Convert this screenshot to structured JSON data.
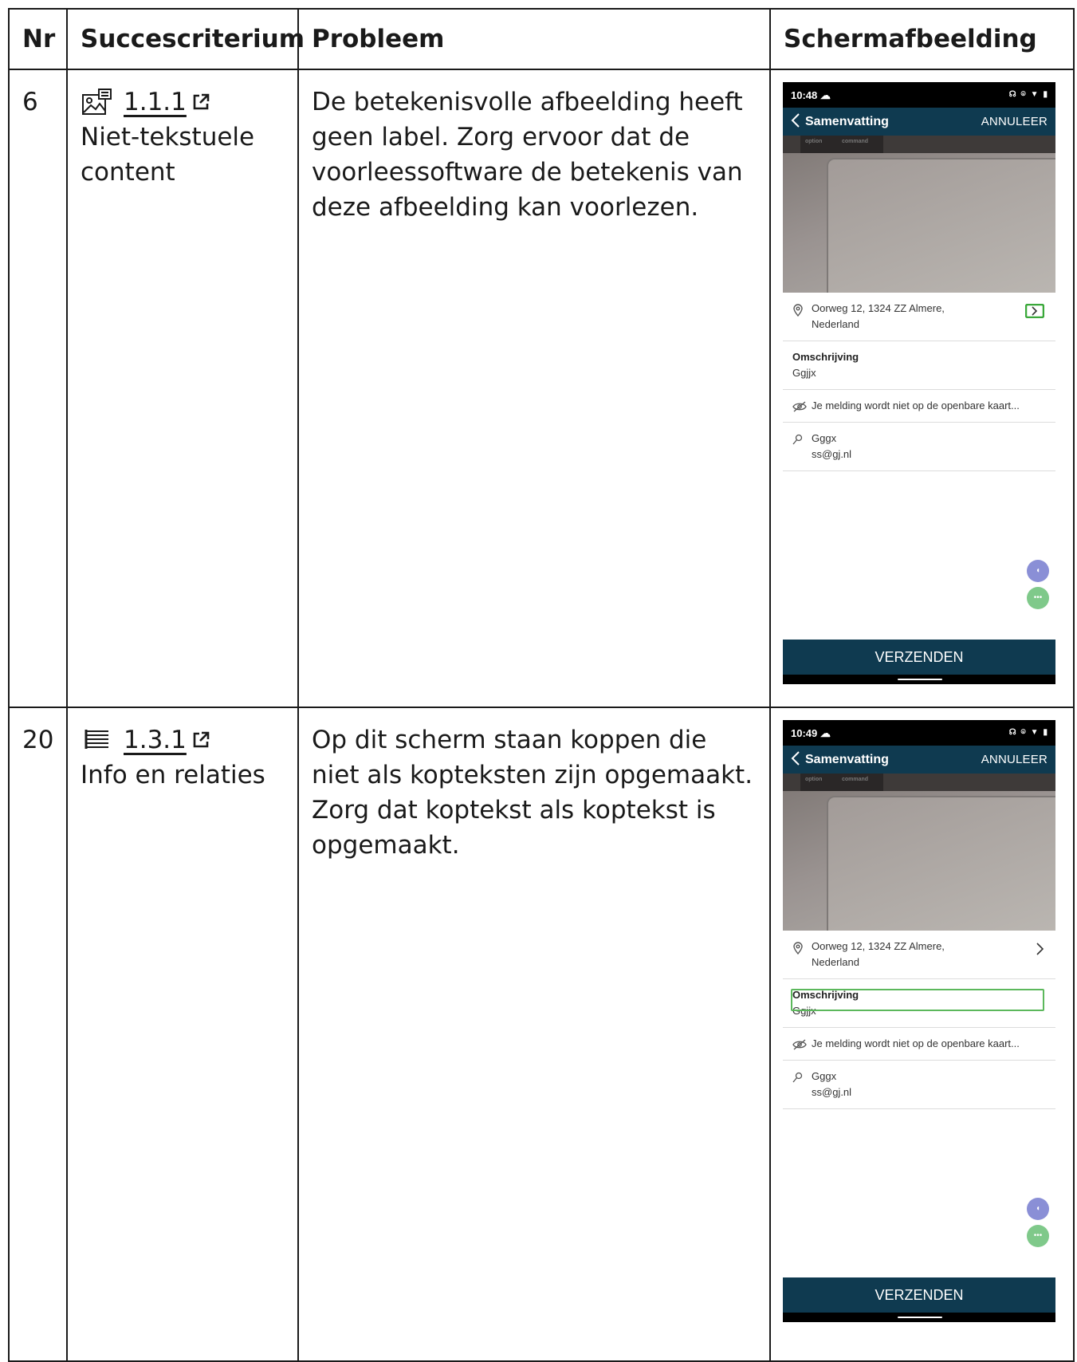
{
  "table": {
    "headers": {
      "nr": "Nr",
      "criterion": "Succescriterium",
      "problem": "Probleem",
      "screenshot": "Schermafbeelding"
    },
    "rows": [
      {
        "nr": "6",
        "criterion_code": "1.1.1",
        "criterion_name": "Niet-tekstuele content",
        "criterion_icon": "image-icon",
        "problem": "De betekenisvolle afbeelding heeft geen label. Zorg ervoor dat de voorleessoftware de betekenis van deze afbeelding kan voorlezen.",
        "screenshot": {
          "time": "10:48",
          "header_title": "Samenvatting",
          "cancel": "ANNULEER",
          "key1": "option",
          "key2": "command",
          "address_line1": "Oorweg 12, 1324 ZZ Almere,",
          "address_line2": "Nederland",
          "description_heading": "Omschrijving",
          "description_value": "Ggjjx",
          "privacy_note": "Je melding wordt niet op de openbare kaart...",
          "user_name": "Gggx",
          "user_email": "ss@gj.nl",
          "send": "VERZENDEN",
          "highlight": "image-chevron"
        }
      },
      {
        "nr": "20",
        "criterion_code": "1.3.1",
        "criterion_name": "Info en relaties",
        "criterion_icon": "list-icon",
        "problem": "Op dit scherm staan koppen die niet als kopteksten zijn opgemaakt. Zorg dat koptekst als koptekst is opgemaakt.",
        "screenshot": {
          "time": "10:49",
          "header_title": "Samenvatting",
          "cancel": "ANNULEER",
          "key1": "option",
          "key2": "command",
          "address_line1": "Oorweg 12, 1324 ZZ Almere,",
          "address_line2": "Nederland",
          "description_heading": "Omschrijving",
          "description_value": "Ggjjx",
          "privacy_note": "Je melding wordt niet op de openbare kaart...",
          "user_name": "Gggx",
          "user_email": "ss@gj.nl",
          "send": "VERZENDEN",
          "highlight": "description-heading"
        }
      }
    ]
  },
  "colors": {
    "app_header": "#0f3a50",
    "focus": "#5cb85c",
    "fab_speaker": "#8a8fd6",
    "fab_more": "#7fc98a"
  }
}
